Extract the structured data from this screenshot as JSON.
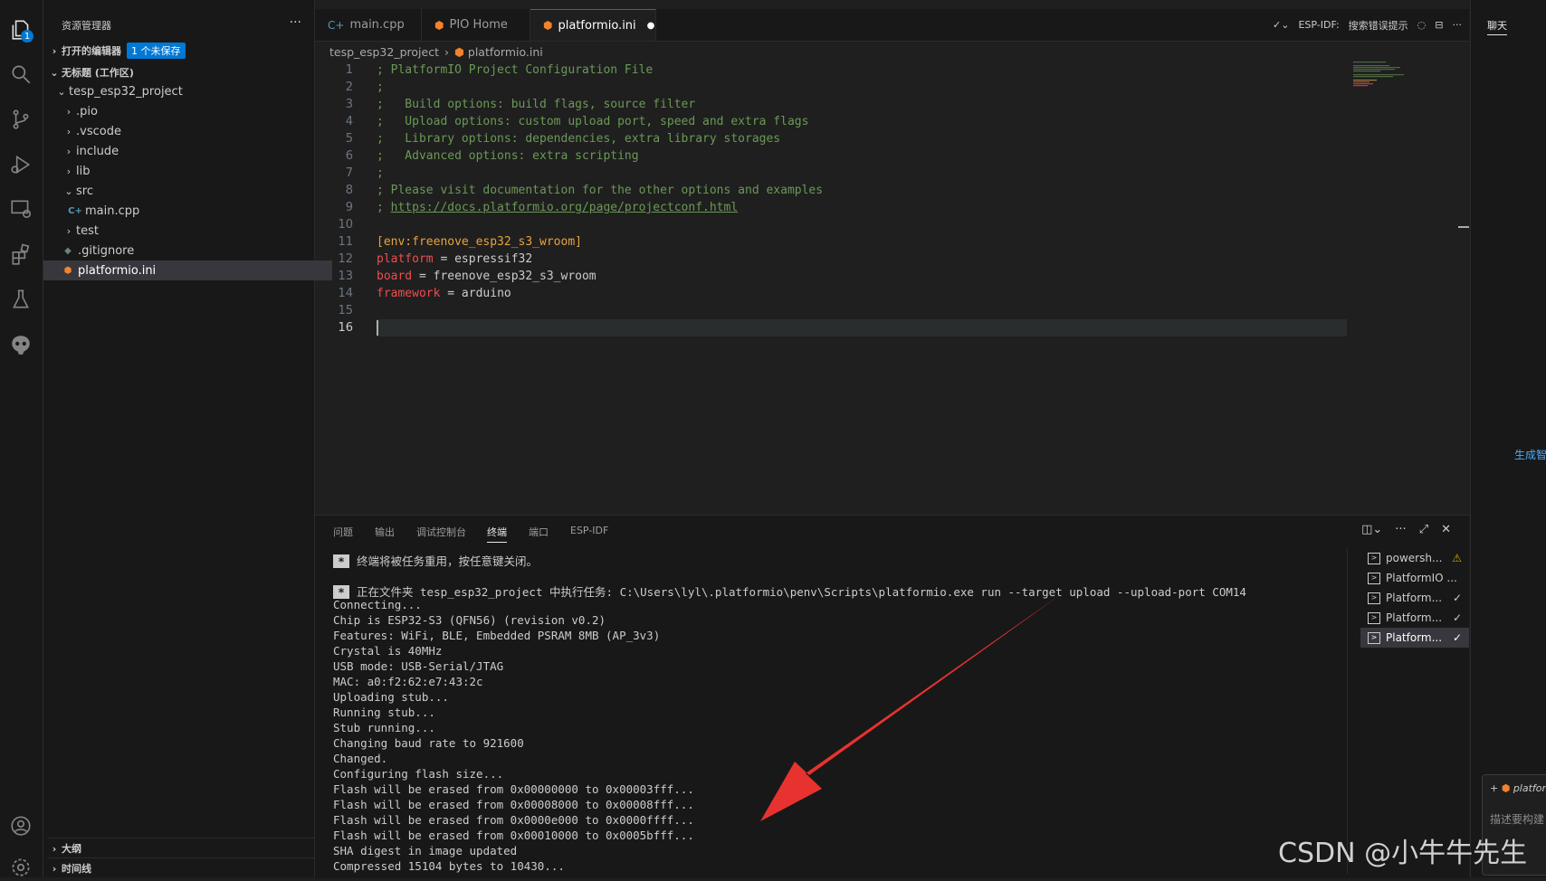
{
  "sidebar": {
    "title": "资源管理器",
    "open_editors": "打开的编辑器",
    "unsaved_badge": "1 个未保存",
    "workspace": "无标题 (工作区)",
    "project": "tesp_esp32_project",
    "items": [
      {
        "label": ".pio"
      },
      {
        "label": ".vscode"
      },
      {
        "label": "include"
      },
      {
        "label": "lib"
      },
      {
        "label": "src"
      },
      {
        "label": "main.cpp"
      },
      {
        "label": "test"
      },
      {
        "label": ".gitignore"
      },
      {
        "label": "platformio.ini"
      }
    ],
    "outline": "大纲",
    "timeline": "时间线"
  },
  "activity": {
    "explorer_badge": "1"
  },
  "tabs": [
    {
      "label": "main.cpp"
    },
    {
      "label": "PIO Home"
    },
    {
      "label": "platformio.ini",
      "dirty": "●"
    }
  ],
  "tab_actions": {
    "esp_idf": "ESP-IDF:",
    "hint": "搜索错误提示"
  },
  "breadcrumb": {
    "folder": "tesp_esp32_project",
    "file": "platformio.ini"
  },
  "code": [
    {
      "n": "1",
      "t": "; PlatformIO Project Configuration File"
    },
    {
      "n": "2",
      "t": ";"
    },
    {
      "n": "3",
      "t": ";   Build options: build flags, source filter"
    },
    {
      "n": "4",
      "t": ";   Upload options: custom upload port, speed and extra flags"
    },
    {
      "n": "5",
      "t": ";   Library options: dependencies, extra library storages"
    },
    {
      "n": "6",
      "t": ";   Advanced options: extra scripting"
    },
    {
      "n": "7",
      "t": ";"
    },
    {
      "n": "8",
      "t": "; Please visit documentation for the other options and examples"
    },
    {
      "n": "9",
      "t": "; ",
      "link": "https://docs.platformio.org/page/projectconf.html"
    },
    {
      "n": "10",
      "t": ""
    },
    {
      "n": "11",
      "t": "[env:freenove_esp32_s3_wroom]"
    },
    {
      "n": "12",
      "k": "platform",
      "v": " = espressif32"
    },
    {
      "n": "13",
      "k": "board",
      "v": " = freenove_esp32_s3_wroom"
    },
    {
      "n": "14",
      "k": "framework",
      "v": " = arduino"
    },
    {
      "n": "15",
      "t": ""
    },
    {
      "n": "16",
      "t": ""
    }
  ],
  "right_panel": {
    "chat": "聊天",
    "generate": "生成智",
    "file_chip": "platfor",
    "input_placeholder": "描述要构建"
  },
  "panel": {
    "tabs": [
      "问题",
      "输出",
      "调试控制台",
      "终端",
      "端口",
      "ESP-IDF"
    ],
    "reuse_msg": "终端将被任务重用，按任意键关闭。",
    "task_msg": "正在文件夹 tesp_esp32_project 中执行任务: C:\\Users\\lyl\\.platformio\\penv\\Scripts\\platformio.exe run --target upload --upload-port COM14",
    "lines": [
      "Connecting...",
      "Chip is ESP32-S3 (QFN56) (revision v0.2)",
      "Features: WiFi, BLE, Embedded PSRAM 8MB (AP_3v3)",
      "Crystal is 40MHz",
      "USB mode: USB-Serial/JTAG",
      "MAC: a0:f2:62:e7:43:2c",
      "Uploading stub...",
      "Running stub...",
      "Stub running...",
      "Changing baud rate to 921600",
      "Changed.",
      "Configuring flash size...",
      "Flash will be erased from 0x00000000 to 0x00003fff...",
      "Flash will be erased from 0x00008000 to 0x00008fff...",
      "Flash will be erased from 0x0000e000 to 0x0000ffff...",
      "Flash will be erased from 0x00010000 to 0x0005bfff...",
      "SHA digest in image updated",
      "Compressed 15104 bytes to 10430..."
    ],
    "terminals": [
      {
        "label": "powersh...",
        "status": "⚠"
      },
      {
        "label": "PlatformIO ...",
        "status": ""
      },
      {
        "label": "Platform...",
        "status": "✓"
      },
      {
        "label": "Platform...",
        "status": "✓"
      },
      {
        "label": "Platform...",
        "status": "✓"
      }
    ]
  },
  "watermark": "CSDN @小牛牛先生"
}
